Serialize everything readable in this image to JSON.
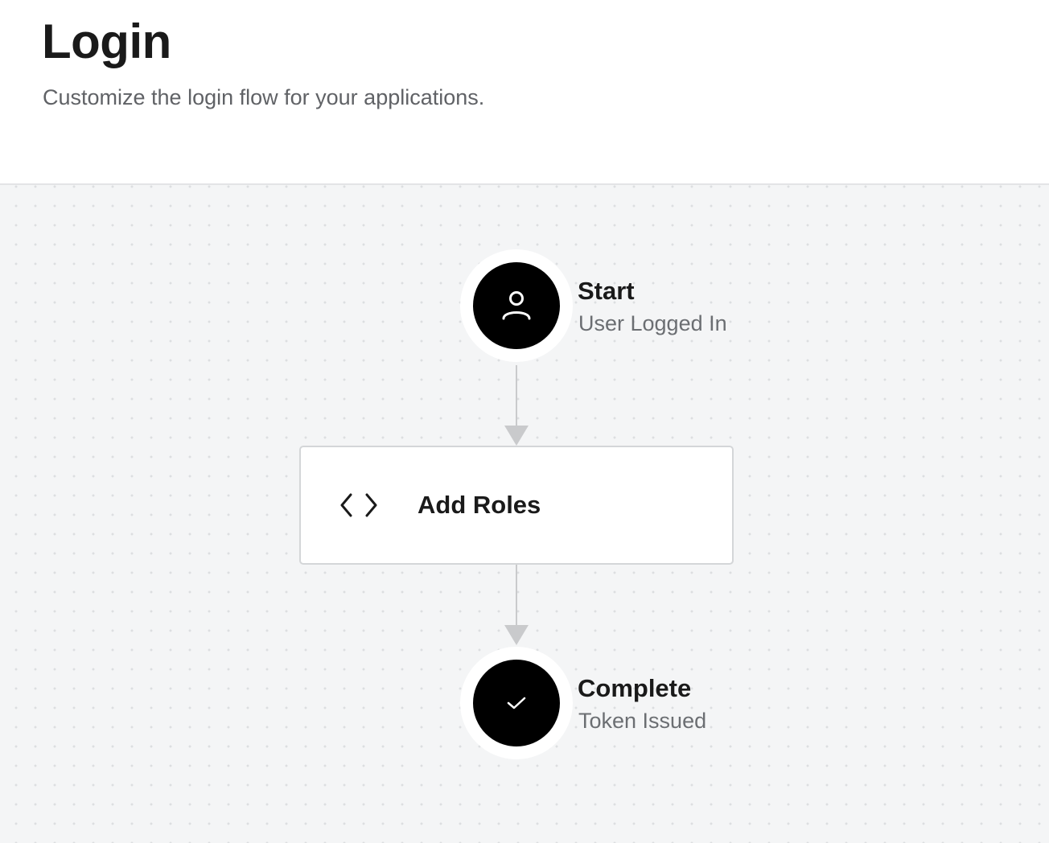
{
  "header": {
    "title": "Login",
    "subtitle": "Customize the login flow for your applications."
  },
  "flow": {
    "start": {
      "icon": "user-icon",
      "title": "Start",
      "subtitle": "User Logged In"
    },
    "action": {
      "icon": "code-icon",
      "label": "Add Roles"
    },
    "complete": {
      "icon": "check-icon",
      "title": "Complete",
      "subtitle": "Token Issued"
    }
  },
  "colors": {
    "node_fill": "#000000",
    "connector": "#c9cacc",
    "canvas_background": "#f4f5f6",
    "card_border": "#d4d6d8"
  }
}
